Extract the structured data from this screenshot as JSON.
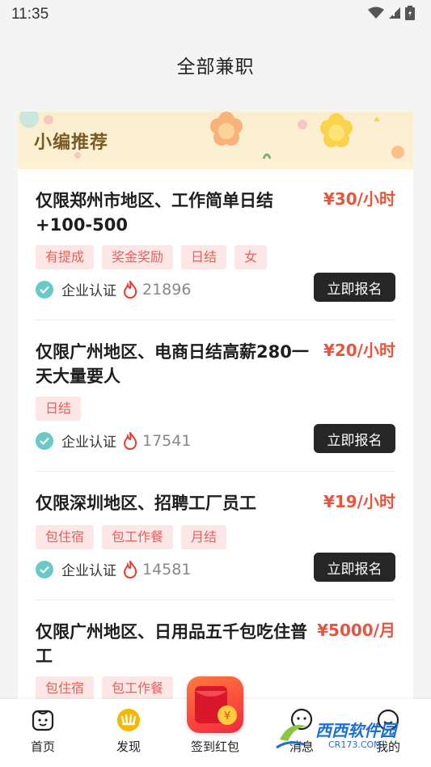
{
  "status_bar": {
    "time": "11:35"
  },
  "header": {
    "title": "全部兼职"
  },
  "banner": {
    "title": "小编推荐"
  },
  "jobs": [
    {
      "title": "仅限郑州市地区、工作简单日结+100-500",
      "salary": "¥30/小时",
      "tags": [
        "有提成",
        "奖金奖励",
        "日结",
        "女"
      ],
      "verify_label": "企业认证",
      "hot_count": "21896",
      "apply_label": "立即报名"
    },
    {
      "title": "仅限广州地区、电商日结高薪280一天大量要人",
      "salary": "¥20/小时",
      "tags": [
        "日结"
      ],
      "verify_label": "企业认证",
      "hot_count": "17541",
      "apply_label": "立即报名"
    },
    {
      "title": "仅限深圳地区、招聘工厂员工",
      "salary": "¥19/小时",
      "tags": [
        "包住宿",
        "包工作餐",
        "月结"
      ],
      "verify_label": "企业认证",
      "hot_count": "14581",
      "apply_label": "立即报名"
    },
    {
      "title": "仅限广州地区、日用品五千包吃住普工",
      "salary": "¥5000/月",
      "tags": [
        "包住宿",
        "包工作餐"
      ]
    }
  ],
  "bottom_nav": {
    "items": [
      {
        "label": "首页",
        "icon": "home-face-icon"
      },
      {
        "label": "发现",
        "icon": "discover-icon"
      },
      {
        "label": "签到红包",
        "icon": "red-packet-icon"
      },
      {
        "label": "消息",
        "icon": "message-icon"
      },
      {
        "label": "我的",
        "icon": "profile-icon"
      }
    ]
  },
  "watermark": {
    "text": "西西软件园",
    "sub": "CR173.COM"
  },
  "colors": {
    "salary": "#e8553f",
    "tag_bg": "#fde7e6",
    "tag_text": "#e2625b",
    "button_bg": "#262626",
    "verify": "#69c9c8",
    "discover_active": "#f5b700"
  }
}
